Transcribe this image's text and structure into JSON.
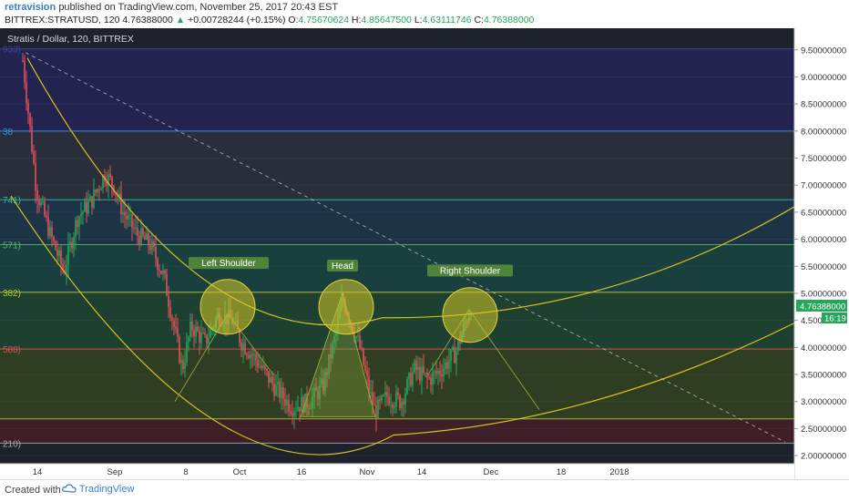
{
  "header": {
    "author": "retravision",
    "published": "published on TradingView.com, November 25, 2017 20:43 EST",
    "symbol": "BITTREX:STRATUSD, 120",
    "last": "4.76388000",
    "change_arrow": "▲",
    "change": "+0.00728244 (+0.15%)",
    "open_label": "O:",
    "open": "4.75670624",
    "high_label": "H:",
    "high": "4.85647500",
    "low_label": "L:",
    "low": "4.63111746",
    "close_label": "C:",
    "close": "4.76388000"
  },
  "footer": {
    "created_with": "Created with",
    "brand": "TradingView"
  },
  "chart_data": {
    "type": "candlestick",
    "title": "Stratis / Dollar, 120, BITTREX",
    "y_axis": {
      "ticks": [
        "9.50000000",
        "9.00000000",
        "8.50000000",
        "8.00000000",
        "7.50000000",
        "7.00000000",
        "6.50000000",
        "6.00000000",
        "5.50000000",
        "5.00000000",
        "4.50000000",
        "4.00000000",
        "3.50000000",
        "3.00000000",
        "2.50000000",
        "2.00000000"
      ],
      "tick_values": [
        9.5,
        9.0,
        8.5,
        8.0,
        7.5,
        7.0,
        6.5,
        6.0,
        5.5,
        5.0,
        4.5,
        4.0,
        3.5,
        3.0,
        2.5,
        2.0
      ],
      "ylim": [
        1.85,
        9.9
      ]
    },
    "x_axis": {
      "ticks": [
        "14",
        "Sep",
        "8",
        "Oct",
        "16",
        "Nov",
        "14",
        "Dec",
        "18",
        "2018"
      ]
    },
    "price_label": "4.76388000",
    "countdown_label": "16:19",
    "fib_levels": [
      {
        "label": "933)",
        "value": 9.52,
        "color": "#3f3f9a"
      },
      {
        "label": "38",
        "value": 8.0,
        "color": "#3a8fd9"
      },
      {
        "label": "741)",
        "value": 6.73,
        "color": "#2fbf9e"
      },
      {
        "label": "571)",
        "value": 5.9,
        "color": "#57b36b"
      },
      {
        "label": "382)",
        "value": 5.02,
        "color": "#b9c23b"
      },
      {
        "label": "588)",
        "value": 3.97,
        "color": "#d9534f"
      },
      {
        "label": "",
        "value": 2.68,
        "color": "#b9c23b"
      },
      {
        "label": "210)",
        "value": 2.23,
        "color": "#aaaaaa"
      }
    ],
    "zone_colors": [
      "#23234f",
      "#2a2d3a",
      "#1d3447",
      "#19403f",
      "#1e4030",
      "#2f3d22",
      "#3e1e27"
    ],
    "annotations": [
      {
        "label": "Left Shoulder"
      },
      {
        "label": "Head"
      },
      {
        "label": "Right Shoulder"
      }
    ],
    "series_color_up": "#26a65b",
    "series_color_down": "#e0525c"
  }
}
